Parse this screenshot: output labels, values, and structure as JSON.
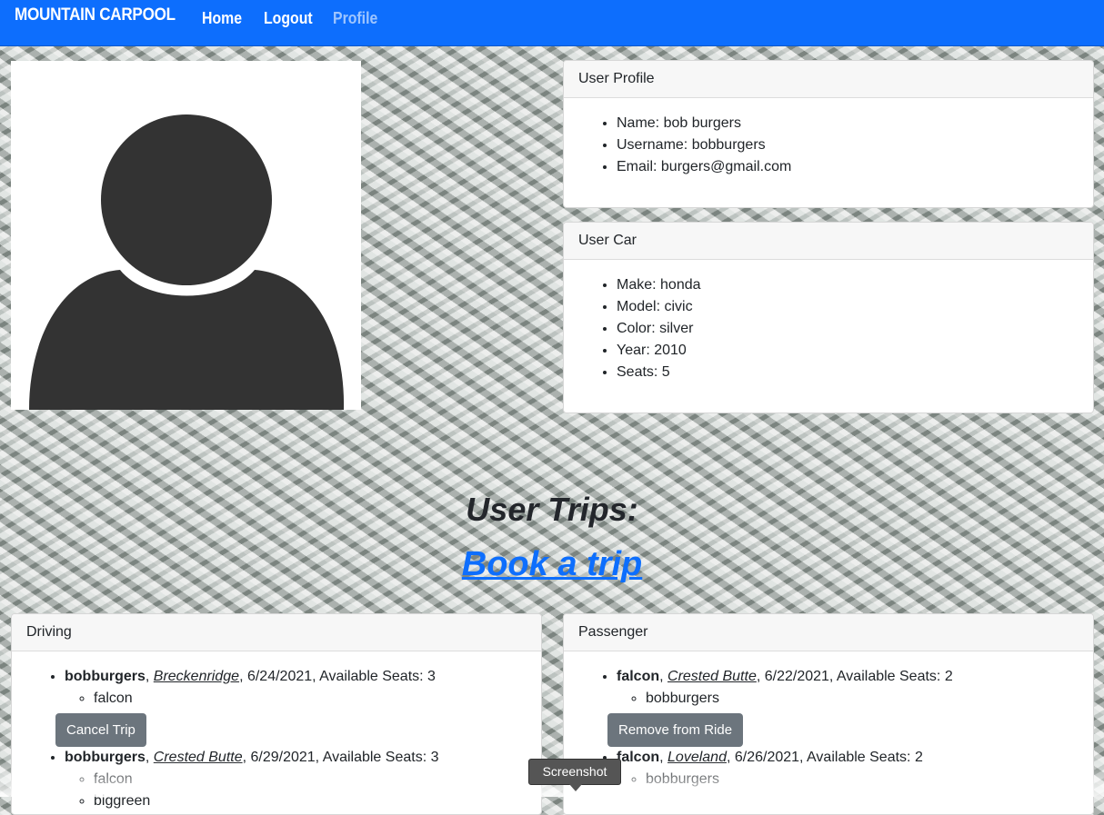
{
  "nav": {
    "brand": "MOUNTAIN CARPOOL",
    "links": [
      "Home",
      "Logout",
      "Profile"
    ]
  },
  "profile": {
    "header": "User Profile",
    "items": [
      "Name: bob burgers",
      "Username: bobburgers",
      "Email: burgers@gmail.com"
    ]
  },
  "car": {
    "header": "User Car",
    "items": [
      "Make: honda",
      "Model: civic",
      "Color: silver",
      "Year: 2010",
      "Seats: 5"
    ]
  },
  "trips": {
    "title": "User Trips:",
    "book_link": "Book a trip"
  },
  "driving": {
    "header": "Driving",
    "trips": [
      {
        "driver": "bobburgers",
        "sep1": ", ",
        "place": "Crested Butte",
        "rest": ", 6/29/2021, Available Seats: 3",
        "passengers": [
          "falcon",
          "biggreen"
        ]
      }
    ],
    "first": {
      "driver": "bobburgers",
      "sep1": ", ",
      "place": "Breckenridge",
      "rest": ", 6/24/2021, Available Seats: 3",
      "passenger": "falcon",
      "button": "Cancel Trip"
    }
  },
  "passenger": {
    "header": "Passenger",
    "first": {
      "driver": "falcon",
      "sep1": ", ",
      "place": "Crested Butte",
      "rest": ", 6/22/2021, Available Seats: 2",
      "passenger": "bobburgers",
      "button": "Remove from Ride"
    },
    "second": {
      "driver": "falcon",
      "sep1": ", ",
      "place": "Loveland",
      "rest": ", 6/26/2021, Available Seats: 2",
      "passenger": "bobburgers"
    }
  },
  "tooltip": "Screenshot",
  "colors": {
    "navbar": "#0d6efd",
    "button": "#6c757d",
    "avatar": "#333333"
  }
}
